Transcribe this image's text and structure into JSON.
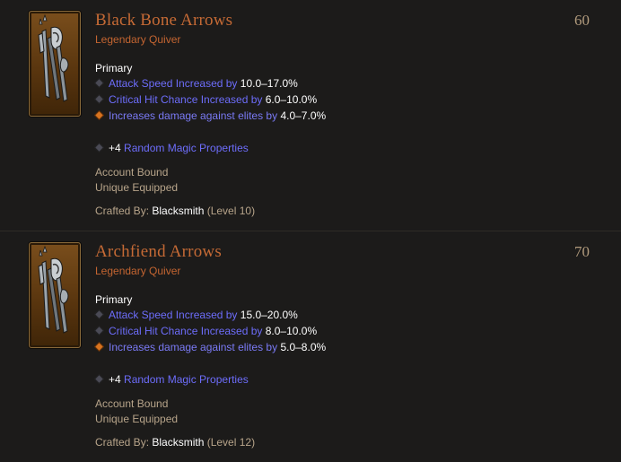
{
  "items": [
    {
      "name": "Black Bone Arrows",
      "level": "60",
      "type": "Legendary Quiver",
      "primary_label": "Primary",
      "affixes": [
        {
          "bullet": "blue",
          "prefix": "Attack Speed Increased by ",
          "value": "10.0–17.0%",
          "suffix": ""
        },
        {
          "bullet": "blue",
          "prefix": "Critical Hit Chance Increased by ",
          "value": "6.0–10.0%",
          "suffix": ""
        },
        {
          "bullet": "orange",
          "prefix": "Increases damage against elites by ",
          "value": "4.0–7.0%",
          "suffix": ""
        }
      ],
      "random": {
        "count": "+4",
        "text": " Random Magic Properties"
      },
      "account_bound": "Account Bound",
      "unique_equipped": "Unique Equipped",
      "crafted": {
        "label": "Crafted By: ",
        "crafter": "Blacksmith",
        "level": " (Level 10)"
      }
    },
    {
      "name": "Archfiend Arrows",
      "level": "70",
      "type": "Legendary Quiver",
      "primary_label": "Primary",
      "affixes": [
        {
          "bullet": "blue",
          "prefix": "Attack Speed Increased by ",
          "value": "15.0–20.0%",
          "suffix": ""
        },
        {
          "bullet": "blue",
          "prefix": "Critical Hit Chance Increased by ",
          "value": "8.0–10.0%",
          "suffix": ""
        },
        {
          "bullet": "orange",
          "prefix": "Increases damage against elites by ",
          "value": "5.0–8.0%",
          "suffix": ""
        }
      ],
      "random": {
        "count": "+4",
        "text": " Random Magic Properties"
      },
      "account_bound": "Account Bound",
      "unique_equipped": "Unique Equipped",
      "crafted": {
        "label": "Crafted By: ",
        "crafter": "Blacksmith",
        "level": " (Level 12)"
      }
    }
  ],
  "icon": "quiver-arrows-icon",
  "colors": {
    "legendary": "#c56a35",
    "magic": "#6d6dfb",
    "value": "#ffffff",
    "muted": "#b7a48a",
    "background": "#1c1b1a"
  }
}
